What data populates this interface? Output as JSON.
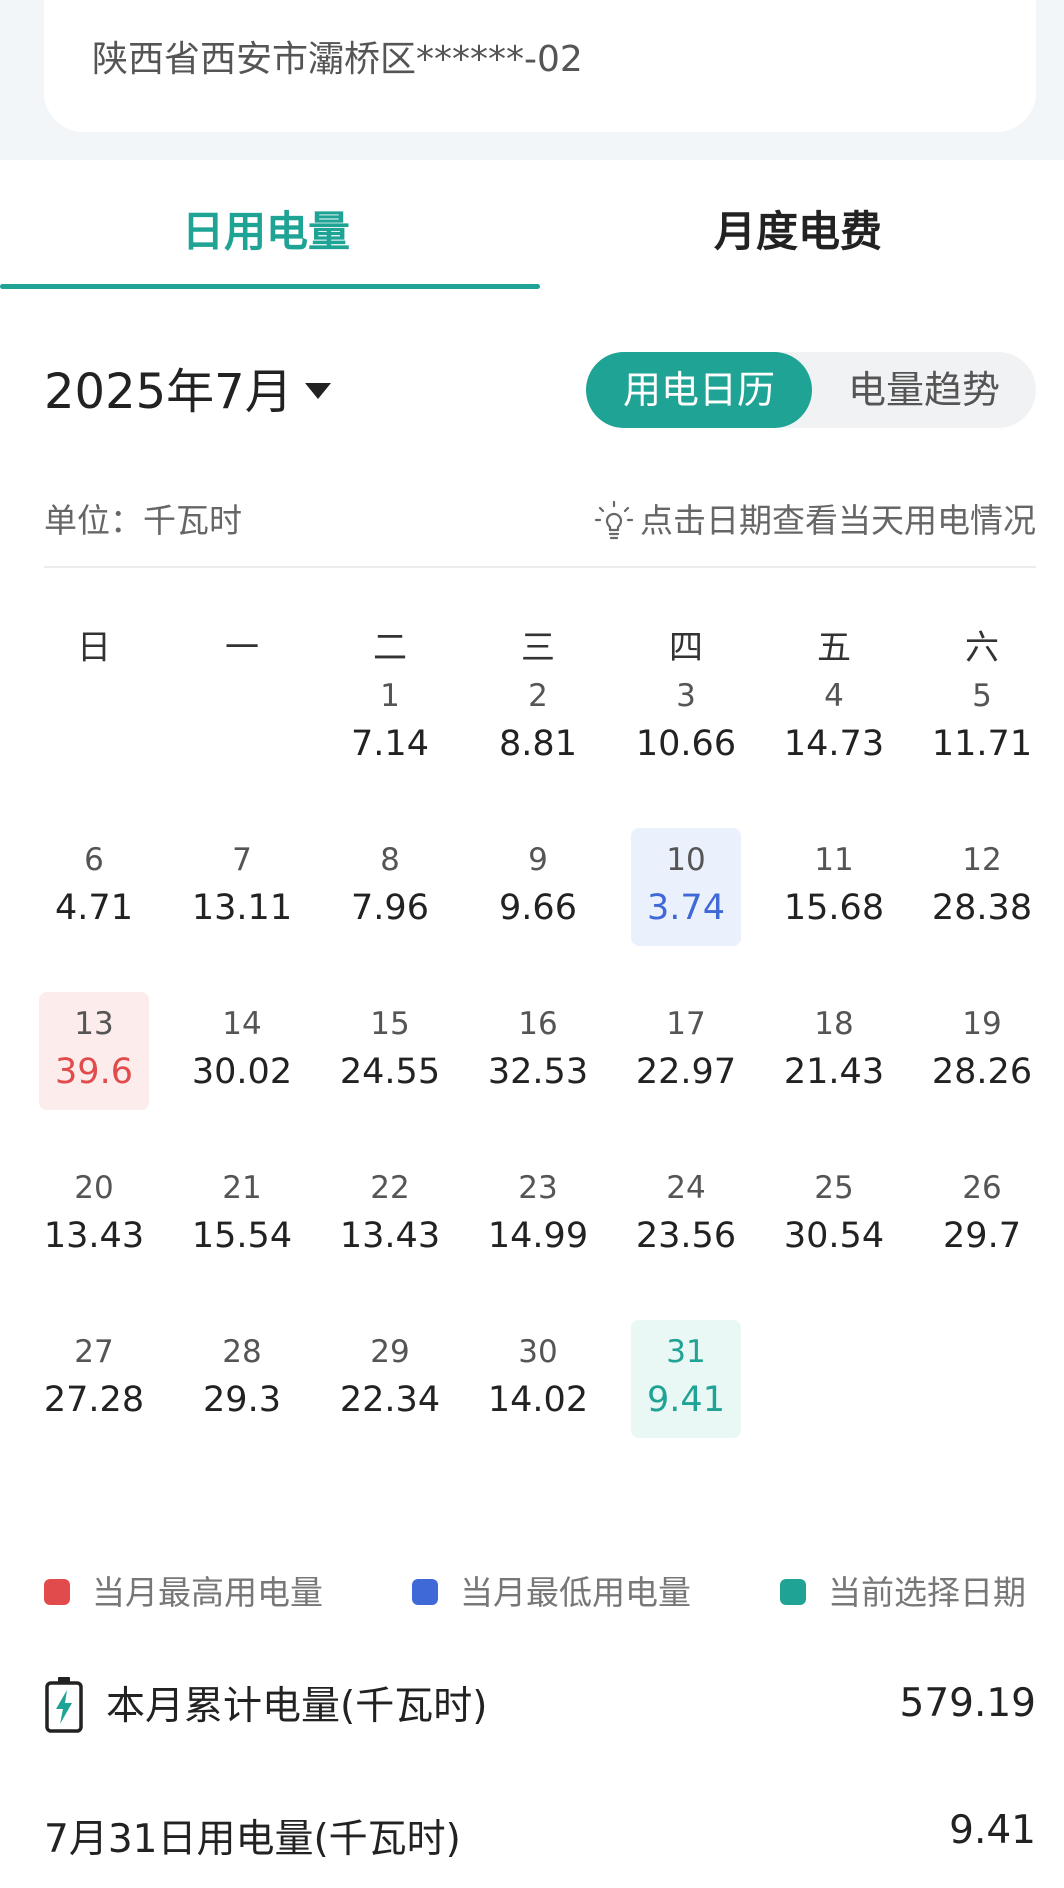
{
  "address": "陕西省西安市灞桥区******-02",
  "tabs": {
    "daily": "日用电量",
    "monthly": "月度电费"
  },
  "month_label": "2025年7月",
  "view_toggle": {
    "calendar": "用电日历",
    "trend": "电量趋势"
  },
  "unit_label": "单位：千瓦时",
  "hint_text": "点击日期查看当天用电情况",
  "weekdays": [
    "日",
    "一",
    "二",
    "三",
    "四",
    "五",
    "六"
  ],
  "days": [
    {
      "day": "1",
      "value": "7.14"
    },
    {
      "day": "2",
      "value": "8.81"
    },
    {
      "day": "3",
      "value": "10.66"
    },
    {
      "day": "4",
      "value": "14.73"
    },
    {
      "day": "5",
      "value": "11.71"
    },
    {
      "day": "6",
      "value": "4.71"
    },
    {
      "day": "7",
      "value": "13.11"
    },
    {
      "day": "8",
      "value": "7.96"
    },
    {
      "day": "9",
      "value": "9.66"
    },
    {
      "day": "10",
      "value": "3.74"
    },
    {
      "day": "11",
      "value": "15.68"
    },
    {
      "day": "12",
      "value": "28.38"
    },
    {
      "day": "13",
      "value": "39.6"
    },
    {
      "day": "14",
      "value": "30.02"
    },
    {
      "day": "15",
      "value": "24.55"
    },
    {
      "day": "16",
      "value": "32.53"
    },
    {
      "day": "17",
      "value": "22.97"
    },
    {
      "day": "18",
      "value": "21.43"
    },
    {
      "day": "19",
      "value": "28.26"
    },
    {
      "day": "20",
      "value": "13.43"
    },
    {
      "day": "21",
      "value": "15.54"
    },
    {
      "day": "22",
      "value": "13.43"
    },
    {
      "day": "23",
      "value": "14.99"
    },
    {
      "day": "24",
      "value": "23.56"
    },
    {
      "day": "25",
      "value": "30.54"
    },
    {
      "day": "26",
      "value": "29.7"
    },
    {
      "day": "27",
      "value": "27.28"
    },
    {
      "day": "28",
      "value": "29.3"
    },
    {
      "day": "29",
      "value": "22.34"
    },
    {
      "day": "30",
      "value": "14.02"
    },
    {
      "day": "31",
      "value": "9.41"
    }
  ],
  "highest_day": "13",
  "lowest_day": "10",
  "selected_day": "31",
  "legend": {
    "high": "当月最高用电量",
    "low": "当月最低用电量",
    "selected": "当前选择日期"
  },
  "colors": {
    "accent": "#1fa394",
    "high": "#e24b4b",
    "low": "#3f69d6"
  },
  "summary": {
    "month_total_label": "本月累计电量(千瓦时)",
    "month_total_value": "579.19",
    "day_label": "7月31日用电量(千瓦时)",
    "day_value": "9.41"
  }
}
